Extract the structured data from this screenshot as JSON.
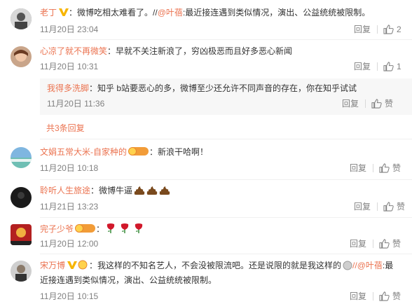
{
  "comments": [
    {
      "name": "老丁",
      "text": "：微博吃相太难看了。//",
      "mention": "@叶蓓",
      "text2": ":最近接连遇到类似情况，演出、公益统统被限制。",
      "time": "11月20日 23:04",
      "reply": "回复",
      "likes": "2"
    },
    {
      "name": "心凉了就不再微笑",
      "text": "：早就不关注新浪了，穷凶极恶而且好多恶心新闻",
      "time": "11月20日 10:31",
      "reply": "回复",
      "likes": "1"
    },
    {
      "name": "我得多洗脚",
      "text": "：知乎 b站要恶心的多，微博至少还允许不同声音的存在，你在知乎试试",
      "time": "11月20日 11:36",
      "reply": "回复",
      "likes": "赞"
    },
    {
      "name": "文娟五常大米-自家种的",
      "text": "：新浪干哈啊！",
      "time": "11月20日 10:18",
      "reply": "回复",
      "likes": "赞"
    },
    {
      "name": "聆听人生旅途",
      "text": "：微博牛逼",
      "time": "11月21日 13:23",
      "reply": "回复",
      "likes": "赞"
    },
    {
      "name": "完子少爷",
      "text": "：",
      "time": "11月20日 12:00",
      "reply": "回复",
      "likes": "赞"
    },
    {
      "name": "宋万博",
      "text": "：我这样的不知名艺人，不会没被限流吧。还是说限的就是我这样的",
      "mention": "//@叶蓓",
      "text2": ":最",
      "line2": "近接连遇到类似情况，演出、公益统统被限制。",
      "time": "11月20日 10:15",
      "reply": "回复",
      "likes": "赞"
    }
  ],
  "more_replies": "共3条回复",
  "fan_badge": "铁粉",
  "colors": {
    "accent": "#eb7350",
    "meta": "#808080",
    "vip": "#f7b500"
  }
}
